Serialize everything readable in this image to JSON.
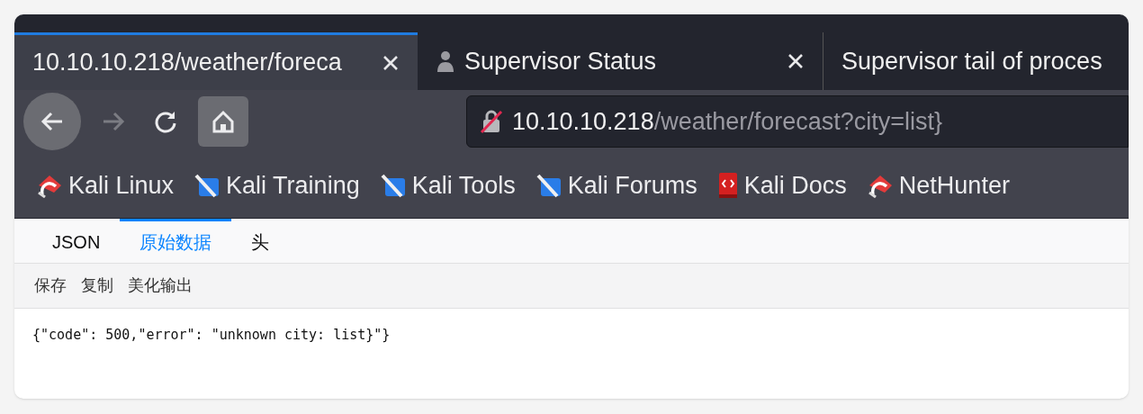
{
  "tabs": [
    {
      "title": "10.10.10.218/weather/foreca",
      "selected": true,
      "has_icon": false,
      "closable": true
    },
    {
      "title": "Supervisor Status",
      "selected": false,
      "has_icon": true,
      "closable": true
    },
    {
      "title": "Supervisor tail of proces",
      "selected": false,
      "has_icon": false
    }
  ],
  "nav": [
    {
      "kind": "back",
      "disabled": false
    },
    {
      "kind": "forward",
      "disabled": true
    },
    {
      "kind": "reload",
      "disabled": false
    },
    {
      "kind": "home",
      "disabled": false
    }
  ],
  "address": {
    "host": "10.10.10.218",
    "path": "/weather/forecast?city=list}",
    "insecure": true
  },
  "bookmarks": [
    {
      "label": "Kali Linux",
      "kind": "dragon"
    },
    {
      "label": "Kali Training",
      "kind": "pen"
    },
    {
      "label": "Kali Tools",
      "kind": "pen"
    },
    {
      "label": "Kali Forums",
      "kind": "pen"
    },
    {
      "label": "Kali Docs",
      "kind": "book"
    },
    {
      "label": "NetHunter",
      "kind": "dragon"
    }
  ],
  "viewer_tabs": [
    {
      "label": "JSON",
      "selected": false
    },
    {
      "label": "原始数据",
      "selected": true
    },
    {
      "label": "头",
      "selected": false
    }
  ],
  "toolbar": [
    "保存",
    "复制",
    "美化输出"
  ],
  "raw_text": "{\"code\": 500,\"error\": \"unknown city: list}\"}"
}
